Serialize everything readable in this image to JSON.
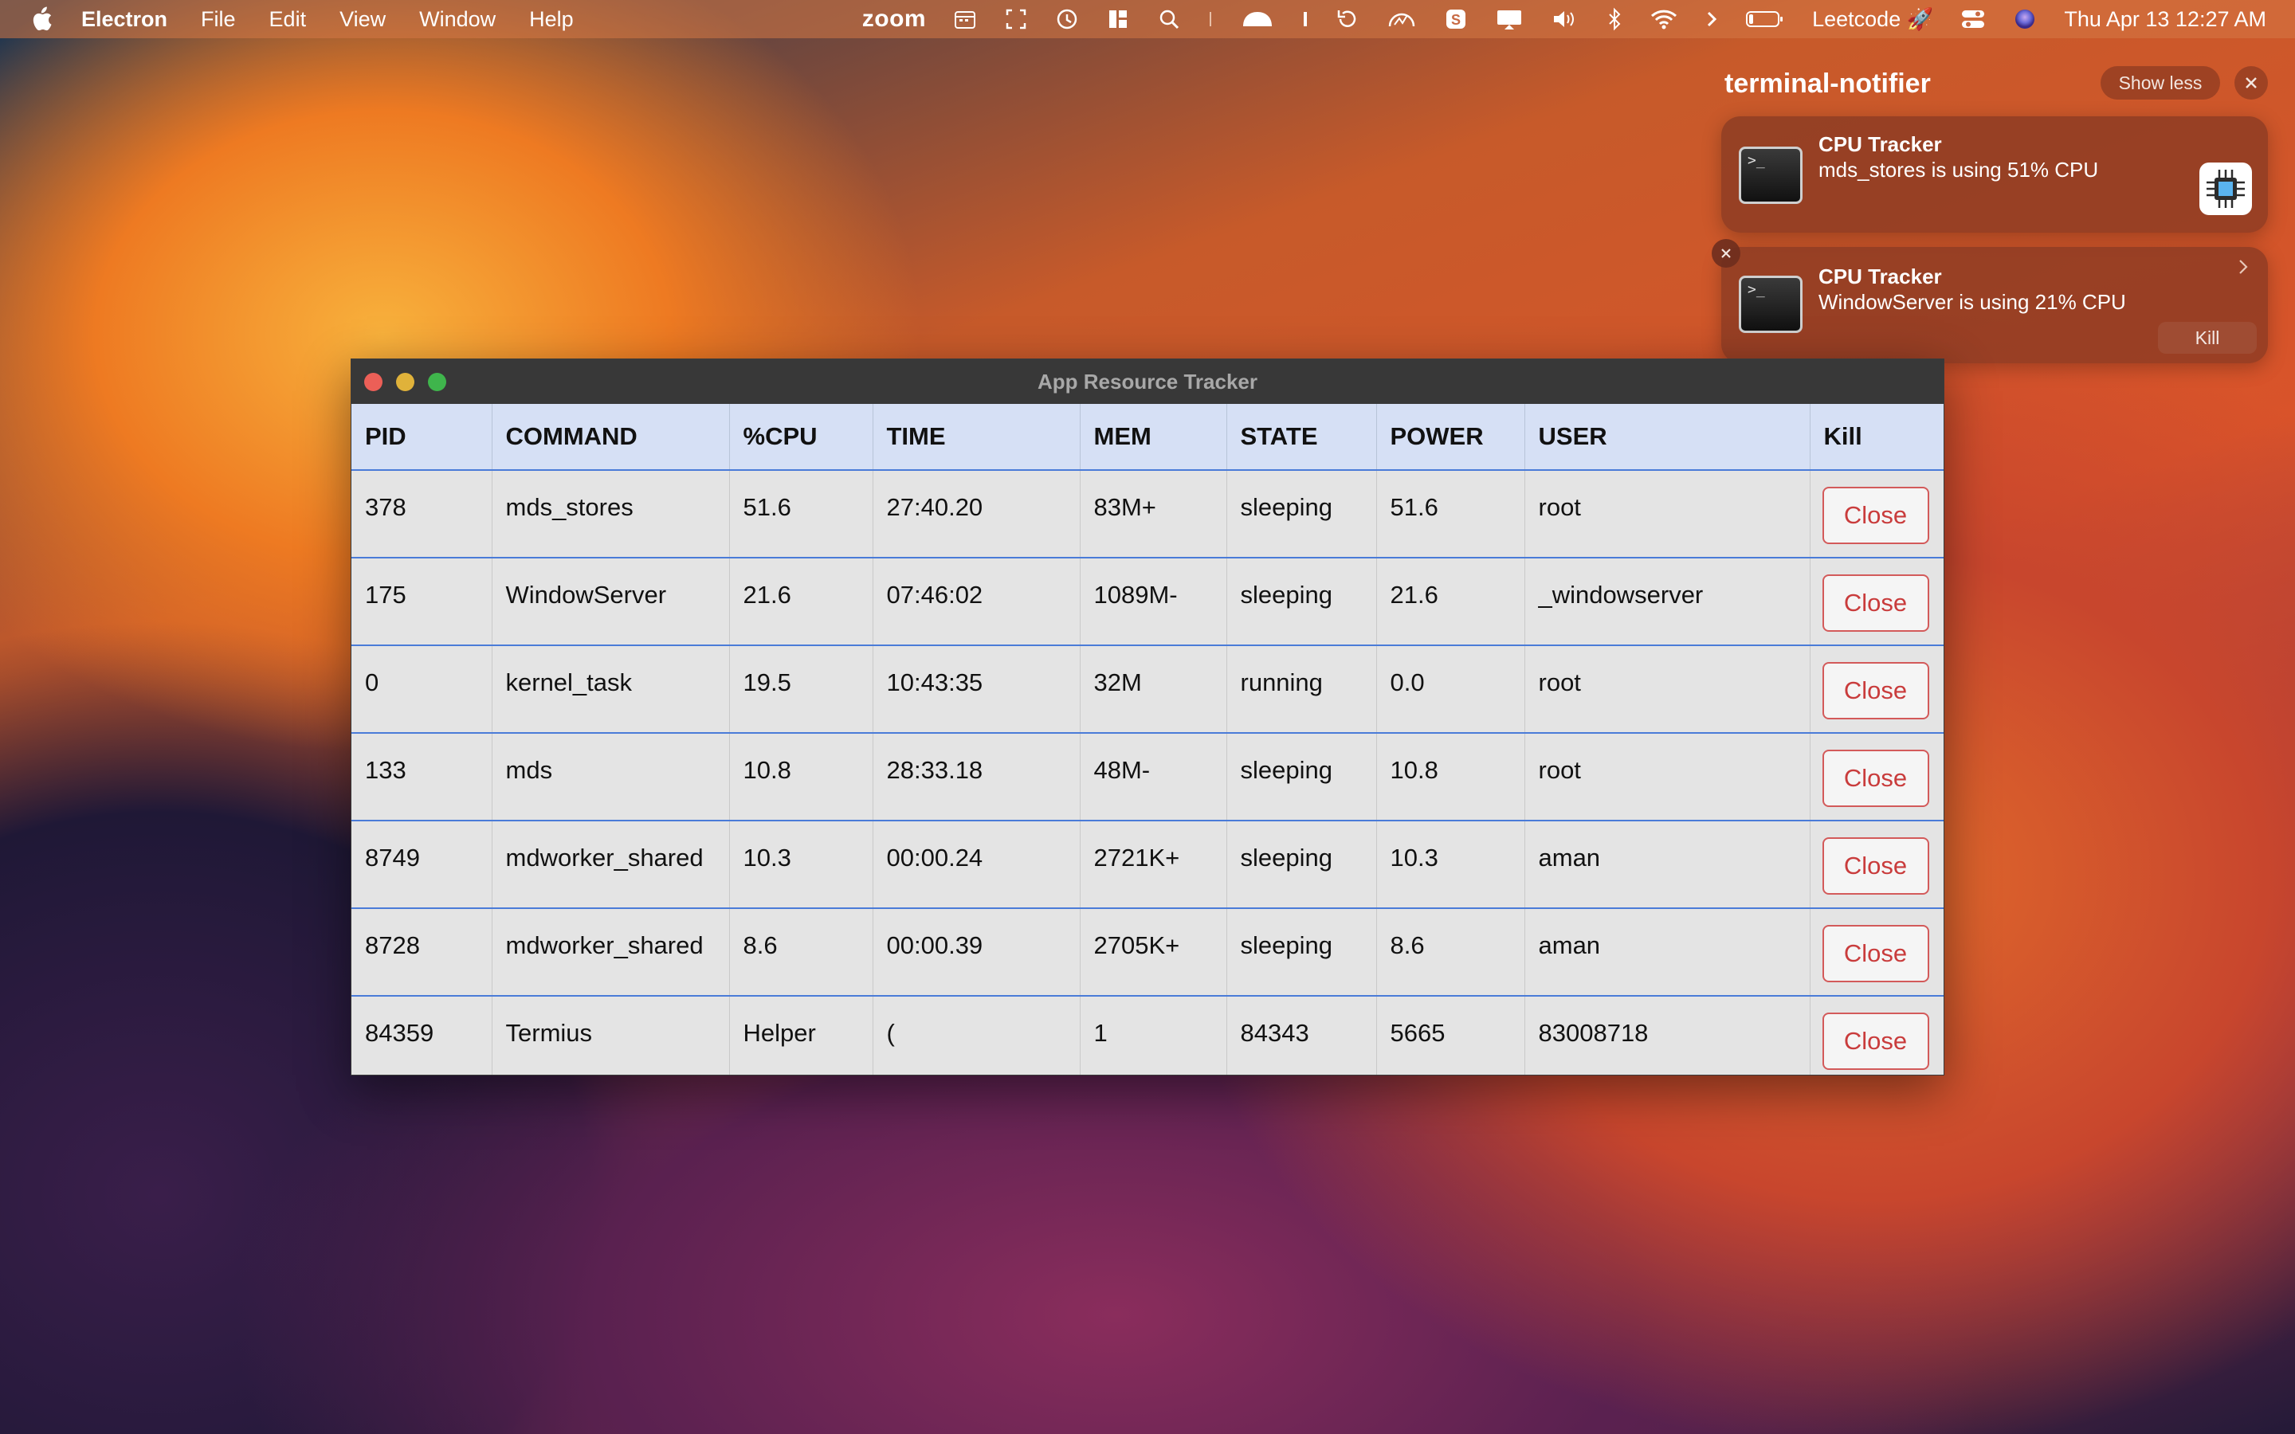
{
  "menubar": {
    "app_name": "Electron",
    "menus": [
      "File",
      "Edit",
      "View",
      "Window",
      "Help"
    ],
    "zoom_label": "zoom",
    "status_label": "Leetcode 🚀",
    "clock": "Thu Apr 13  12:27 AM"
  },
  "notifications": {
    "group_title": "terminal-notifier",
    "show_less_label": "Show less",
    "items": [
      {
        "title": "CPU Tracker",
        "body": "mds_stores is using 51% CPU"
      },
      {
        "title": "CPU Tracker",
        "body": "WindowServer is using 21% CPU",
        "action": "Kill"
      }
    ]
  },
  "window": {
    "title": "App Resource Tracker",
    "columns": [
      "PID",
      "COMMAND",
      "%CPU",
      "TIME",
      "MEM",
      "STATE",
      "POWER",
      "USER",
      "Kill"
    ],
    "rows": [
      {
        "pid": "378",
        "command": "mds_stores",
        "cpu": "51.6",
        "time": "27:40.20",
        "mem": "83M+",
        "state": "sleeping",
        "power": "51.6",
        "user": "root",
        "kill": "Close"
      },
      {
        "pid": "175",
        "command": "WindowServer",
        "cpu": "21.6",
        "time": "07:46:02",
        "mem": "1089M-",
        "state": "sleeping",
        "power": "21.6",
        "user": "_windowserver",
        "kill": "Close"
      },
      {
        "pid": "0",
        "command": "kernel_task",
        "cpu": "19.5",
        "time": "10:43:35",
        "mem": "32M",
        "state": "running",
        "power": "0.0",
        "user": "root",
        "kill": "Close"
      },
      {
        "pid": "133",
        "command": "mds",
        "cpu": "10.8",
        "time": "28:33.18",
        "mem": "48M-",
        "state": "sleeping",
        "power": "10.8",
        "user": "root",
        "kill": "Close"
      },
      {
        "pid": "8749",
        "command": "mdworker_shared",
        "cpu": "10.3",
        "time": "00:00.24",
        "mem": "2721K+",
        "state": "sleeping",
        "power": "10.3",
        "user": "aman",
        "kill": "Close"
      },
      {
        "pid": "8728",
        "command": "mdworker_shared",
        "cpu": "8.6",
        "time": "00:00.39",
        "mem": "2705K+",
        "state": "sleeping",
        "power": "8.6",
        "user": "aman",
        "kill": "Close"
      },
      {
        "pid": "84359",
        "command": "Termius",
        "cpu": "Helper",
        "time": "(",
        "mem": "1",
        "state": "84343",
        "power": "5665",
        "user": "83008718",
        "kill": "Close"
      }
    ]
  },
  "colors": {
    "header_bg": "#d6e0f5",
    "row_divider": "#4a7bd8",
    "close_button": "#c93c3c",
    "traffic_red": "#ec5f57",
    "traffic_yellow": "#e0b23a",
    "traffic_green": "#3fb54c"
  },
  "icons": {
    "menubar_left": "apple-icon",
    "menubar_right": [
      "calendar-icon",
      "fullscreen-icon",
      "history-icon",
      "layout-icon",
      "search-icon",
      "divider-icon",
      "helmet-icon",
      "cursor-icon",
      "refresh-icon",
      "gauge-icon",
      "skype-icon",
      "display-icon",
      "volume-icon",
      "bluetooth-icon",
      "wifi-icon",
      "chevron-right-icon",
      "battery-icon",
      "control-center-icon",
      "siri-icon"
    ]
  }
}
